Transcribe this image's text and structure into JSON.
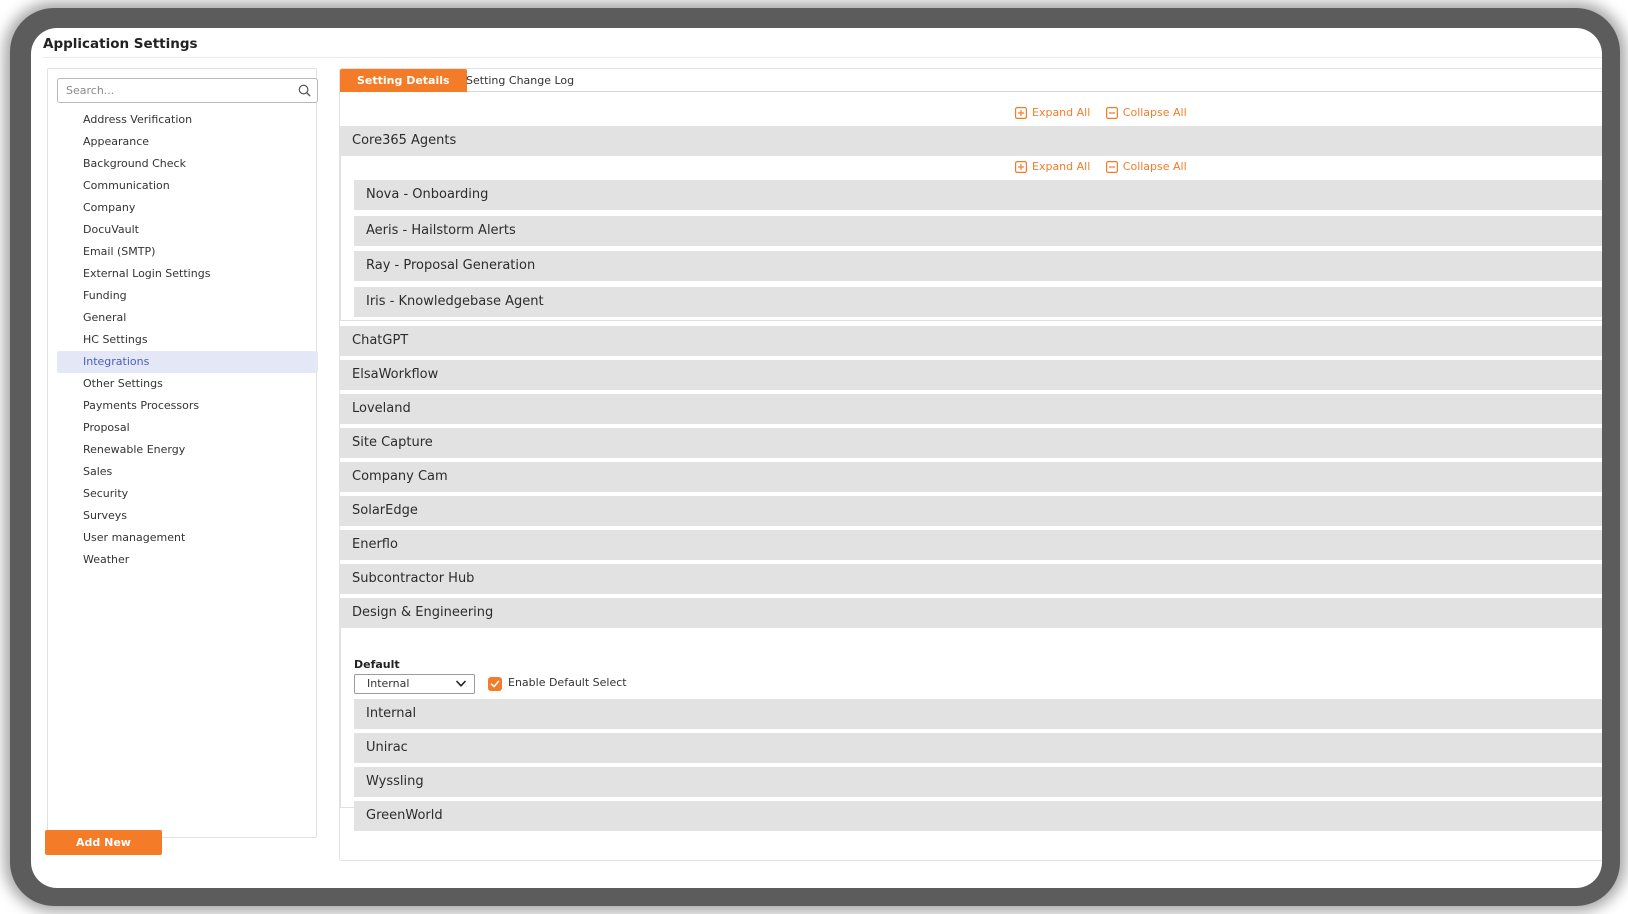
{
  "app": {
    "title": "Application Settings"
  },
  "colors": {
    "accent": "#f47c28",
    "active_nav_bg": "#e4e8f6",
    "active_nav_text": "#4a5fc1",
    "panel_gray": "#e2e2e2"
  },
  "search": {
    "placeholder": "Search...",
    "value": "",
    "icon": "search-icon"
  },
  "sidebar": {
    "items": [
      {
        "label": "Address Verification"
      },
      {
        "label": "Appearance"
      },
      {
        "label": "Background Check"
      },
      {
        "label": "Communication"
      },
      {
        "label": "Company"
      },
      {
        "label": "DocuVault"
      },
      {
        "label": "Email (SMTP)"
      },
      {
        "label": "External Login Settings"
      },
      {
        "label": "Funding"
      },
      {
        "label": "General"
      },
      {
        "label": "HC Settings"
      },
      {
        "label": "Integrations",
        "active": true
      },
      {
        "label": "Other Settings"
      },
      {
        "label": "Payments Processors"
      },
      {
        "label": "Proposal"
      },
      {
        "label": "Renewable Energy"
      },
      {
        "label": "Sales"
      },
      {
        "label": "Security"
      },
      {
        "label": "Surveys"
      },
      {
        "label": "User management"
      },
      {
        "label": "Weather"
      }
    ]
  },
  "tabs": [
    {
      "label": "Setting Details",
      "active": true
    },
    {
      "label": "Setting Change Log",
      "active": false
    }
  ],
  "controls": {
    "expand_all": "Expand All",
    "collapse_all": "Collapse All"
  },
  "sections": {
    "core365": {
      "title": "Core365 Agents",
      "items": [
        "Nova - Onboarding",
        "Aeris - Hailstorm Alerts",
        "Ray - Proposal Generation",
        "Iris - Knowledgebase Agent"
      ]
    },
    "middle": [
      "ChatGPT",
      "ElsaWorkflow",
      "Loveland",
      "Site Capture",
      "Company Cam",
      "SolarEdge",
      "Enerflo",
      "Subcontractor Hub"
    ],
    "design": {
      "title": "Design & Engineering",
      "default_label": "Default",
      "default_value": "Internal",
      "checkbox_label": "Enable Default Select",
      "checkbox_checked": true,
      "items": [
        "Internal",
        "Unirac",
        "Wyssling",
        "GreenWorld"
      ]
    }
  },
  "footer": {
    "add_new_label": "Add New"
  }
}
